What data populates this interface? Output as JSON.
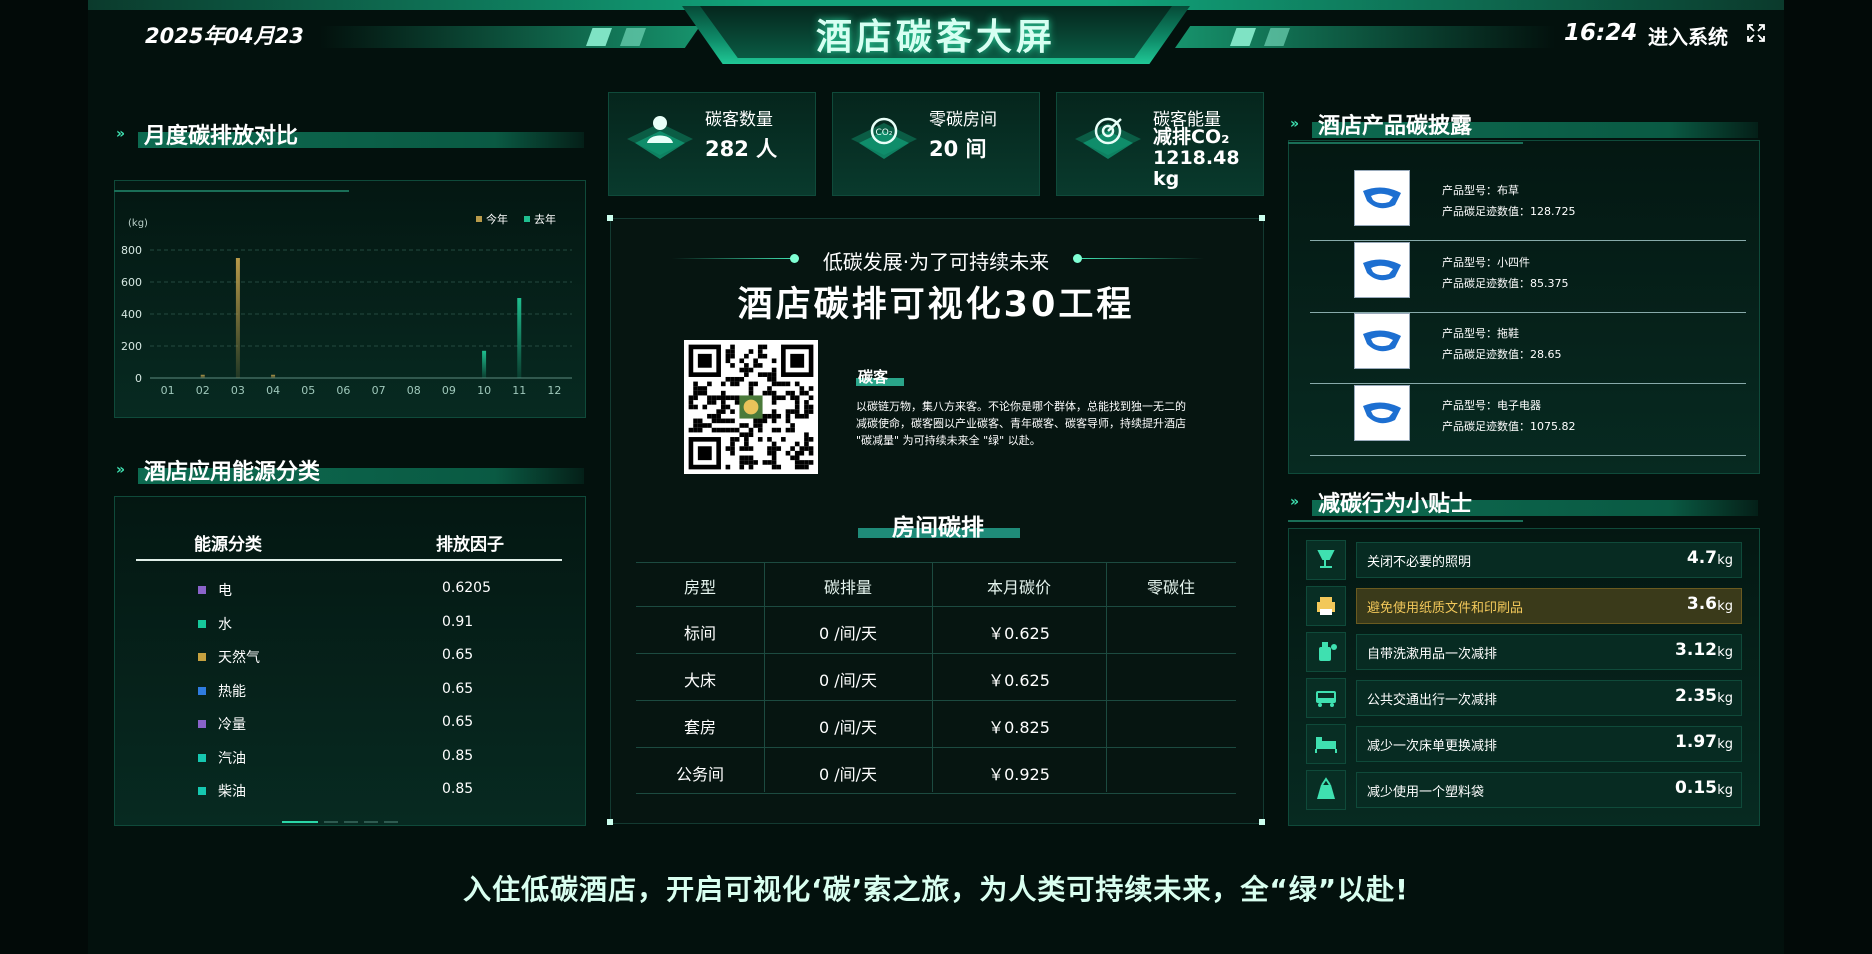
{
  "header": {
    "date": "2025年04月23",
    "title": "酒店碳客大屏",
    "time": "16:24",
    "enter_label": "进入系统"
  },
  "left": {
    "monthly": {
      "title": "月度碳排放对比"
    },
    "energy": {
      "title": "酒店应用能源分类",
      "col1": "能源分类",
      "col2": "排放因子",
      "rows": [
        {
          "name": "电",
          "value": "0.6205",
          "color": "#8a63c9"
        },
        {
          "name": "水",
          "value": "0.91",
          "color": "#16c79a"
        },
        {
          "name": "天然气",
          "value": "0.65",
          "color": "#c6a13f"
        },
        {
          "name": "热能",
          "value": "0.65",
          "color": "#2f7ce0"
        },
        {
          "name": "冷量",
          "value": "0.65",
          "color": "#8a63c9"
        },
        {
          "name": "汽油",
          "value": "0.85",
          "color": "#16c7b0"
        },
        {
          "name": "柴油",
          "value": "0.85",
          "color": "#16c7b0"
        }
      ]
    }
  },
  "chart_data": {
    "type": "bar",
    "ylabel": "(kg)",
    "categories": [
      "01",
      "02",
      "03",
      "04",
      "05",
      "06",
      "07",
      "08",
      "09",
      "10",
      "11",
      "12"
    ],
    "ylim": [
      0,
      800
    ],
    "yticks": [
      "0",
      "200",
      "400",
      "600",
      "800"
    ],
    "legend_position": "top-right",
    "grid": true,
    "series": [
      {
        "name": "今年",
        "color": "#b89a4a",
        "values": [
          0,
          20,
          750,
          20,
          0,
          0,
          0,
          0,
          0,
          0,
          0,
          0
        ]
      },
      {
        "name": "去年",
        "color": "#1fbf8f",
        "values": [
          0,
          0,
          0,
          0,
          0,
          0,
          0,
          0,
          0,
          170,
          500,
          0
        ]
      }
    ]
  },
  "stats": [
    {
      "label": "碳客数量",
      "value": "282 人"
    },
    {
      "label": "零碳房间",
      "value": "20 间"
    },
    {
      "label": "碳客能量",
      "value": "减排CO₂ 1218.48 kg"
    }
  ],
  "center": {
    "slogan": "低碳发展·为了可持续未来",
    "project_title": "酒店碳排可视化30工程",
    "tanke_label": "碳客",
    "tanke_desc": "以碳链万物，集八方来客。不论你是哪个群体，总能找到独一无二的 减碳使命，碳客圈以产业碳客、青年碳客、碳客导师，持续提升酒店 \"碳减量\" 为可持续未来全 \"绿\" 以赴。",
    "room_title": "房间碳排",
    "table_headers": [
      "房型",
      "碳排量",
      "本月碳价",
      "零碳住"
    ],
    "rows": [
      {
        "type": "标间",
        "emission": "0 /间/天",
        "price": "￥0.625",
        "zero": ""
      },
      {
        "type": "大床",
        "emission": "0 /间/天",
        "price": "￥0.625",
        "zero": ""
      },
      {
        "type": "套房",
        "emission": "0 /间/天",
        "price": "￥0.825",
        "zero": ""
      },
      {
        "type": "公务间",
        "emission": "0 /间/天",
        "price": "￥0.925",
        "zero": ""
      }
    ]
  },
  "right": {
    "products": {
      "title": "酒店产品碳披露",
      "items": [
        {
          "model": "产品型号：布草",
          "footprint": "产品碳足迹数值：128.725"
        },
        {
          "model": "产品型号：小四件",
          "footprint": "产品碳足迹数值：85.375"
        },
        {
          "model": "产品型号：拖鞋",
          "footprint": "产品碳足迹数值：28.65"
        },
        {
          "model": "产品型号：电子电器",
          "footprint": "产品碳足迹数值：1075.82"
        }
      ]
    },
    "tips": {
      "title": "减碳行为小贴士",
      "items": [
        {
          "text": "关闭不必要的照明",
          "value": "4.7",
          "unit": "kg",
          "icon": "lamp-icon"
        },
        {
          "text": "避免使用纸质文件和印刷品",
          "value": "3.6",
          "unit": "kg",
          "icon": "printer-icon"
        },
        {
          "text": "自带洗漱用品一次减排",
          "value": "3.12",
          "unit": "kg",
          "icon": "toiletries-icon"
        },
        {
          "text": "公共交通出行一次减排",
          "value": "2.35",
          "unit": "kg",
          "icon": "bus-icon"
        },
        {
          "text": "减少一次床单更换减排",
          "value": "1.97",
          "unit": "kg",
          "icon": "bed-icon"
        },
        {
          "text": "减少使用一个塑料袋",
          "value": "0.15",
          "unit": "kg",
          "icon": "bag-icon"
        }
      ]
    }
  },
  "footer": {
    "slogan": "入住低碳酒店，开启可视化‘碳’索之旅，为人类可持续未来，全“绿”以赴!"
  }
}
